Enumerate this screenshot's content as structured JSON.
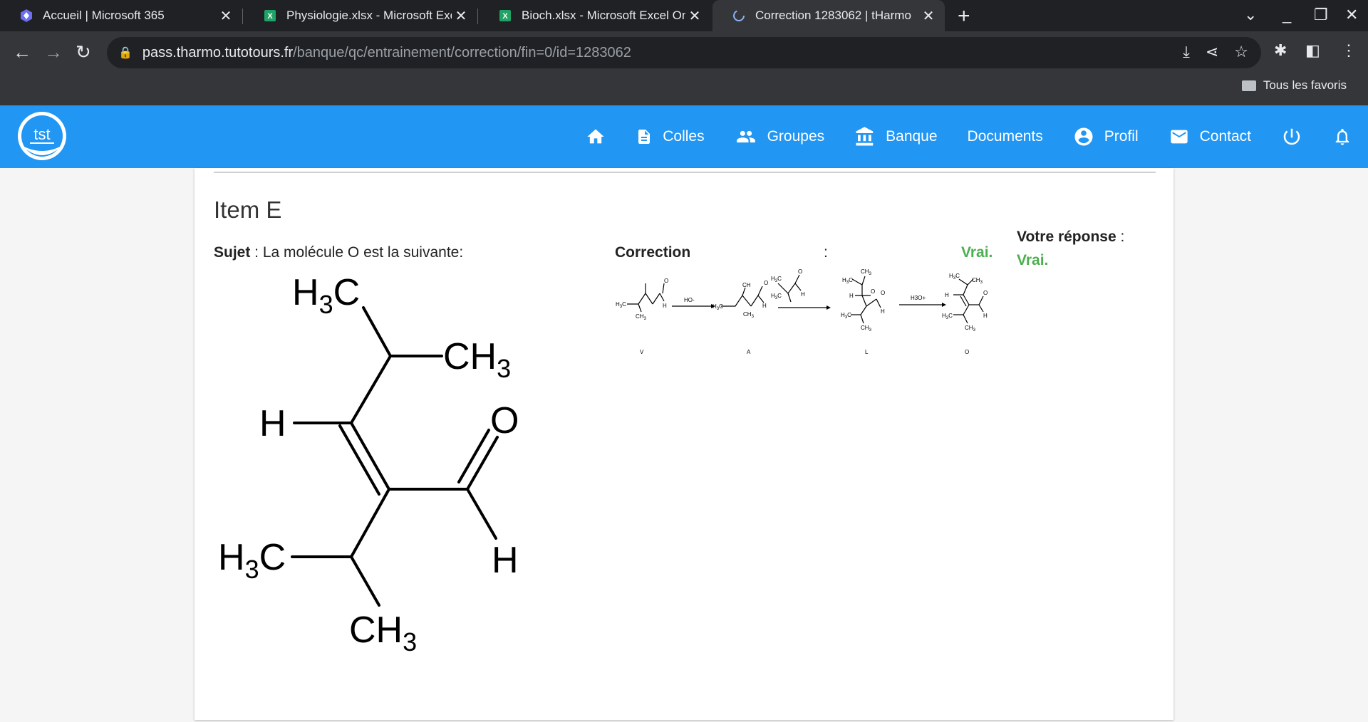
{
  "browser": {
    "tabs": [
      {
        "title": "Accueil | Microsoft 365",
        "icon": "microsoft365-icon"
      },
      {
        "title": "Physiologie.xlsx - Microsoft Excel Online",
        "icon": "excel-icon"
      },
      {
        "title": "Bioch.xlsx - Microsoft Excel Online",
        "icon": "excel-icon"
      },
      {
        "title": "Correction 1283062 | tHarmo",
        "icon": "loading-icon"
      }
    ],
    "url_domain": "pass.tharmo.tutotours.fr",
    "url_path": "/banque/qc/entrainement/correction/fin=0/id=1283062",
    "bookmarks_label": "Tous les favoris"
  },
  "site": {
    "logo_text": "tst",
    "nav": [
      "Colles",
      "Groupes",
      "Banque",
      "Documents",
      "Profil",
      "Contact"
    ]
  },
  "item": {
    "title": "Item E",
    "sujet_label": "Sujet",
    "sujet_text": " : La molécule O est la suivante:",
    "correction_label": "Correction",
    "correction_colon": ":",
    "correction_value": "Vrai.",
    "votre_label": "Votre réponse",
    "votre_colon": " :",
    "votre_value": "Vrai."
  },
  "molecule": {
    "h3c_top": "H3C",
    "ch3_right": "CH3",
    "h_left": "H",
    "o": "O",
    "h3c_bottom": "H3C",
    "h_bottom": "H",
    "ch3_bottom": "CH3"
  },
  "scheme": {
    "labels": [
      "V",
      "A",
      "L",
      "O"
    ],
    "reagent1": "HO-",
    "reagent3": "H3O+"
  }
}
